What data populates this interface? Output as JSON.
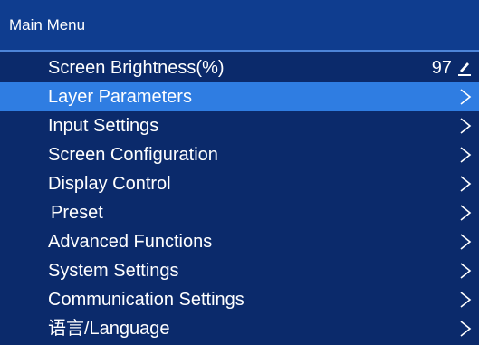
{
  "title": "Main Menu",
  "items": [
    {
      "label": "Screen Brightness(%)",
      "value": "97",
      "icon": "edit-icon",
      "selected": false
    },
    {
      "label": "Layer Parameters",
      "icon": "chevron-right-icon",
      "selected": true
    },
    {
      "label": "Input Settings",
      "icon": "chevron-right-icon",
      "selected": false
    },
    {
      "label": "Screen Configuration",
      "icon": "chevron-right-icon",
      "selected": false
    },
    {
      "label": "Display Control",
      "icon": "chevron-right-icon",
      "selected": false
    },
    {
      "label": "Preset",
      "icon": "chevron-right-icon",
      "selected": false
    },
    {
      "label": "Advanced Functions",
      "icon": "chevron-right-icon",
      "selected": false
    },
    {
      "label": "System Settings",
      "icon": "chevron-right-icon",
      "selected": false
    },
    {
      "label": "Communication Settings",
      "icon": "chevron-right-icon",
      "selected": false
    },
    {
      "label": "语言/Language",
      "icon": "chevron-right-icon",
      "selected": false
    }
  ],
  "colors": {
    "background": "#0b2a6b",
    "title_bar": "#0f3d8f",
    "selected": "#2f7de2",
    "text": "#ffffff"
  }
}
